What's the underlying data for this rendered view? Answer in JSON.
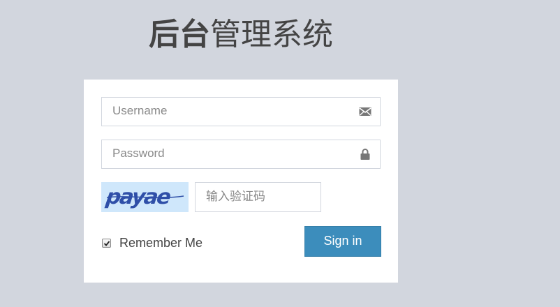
{
  "header": {
    "title_bold": "后台",
    "title_light": "管理系统"
  },
  "form": {
    "username": {
      "placeholder": "Username",
      "icon": "envelope-icon"
    },
    "password": {
      "placeholder": "Password",
      "icon": "lock-icon"
    },
    "captcha": {
      "image_text": "payae",
      "placeholder": "输入验证码"
    },
    "remember": {
      "label": "Remember Me",
      "checked": true
    },
    "submit_label": "Sign in"
  },
  "colors": {
    "background": "#d2d6de",
    "primary": "#3c8dbc",
    "captcha_bg": "#cfe7fb",
    "captcha_text": "#2f4fa8"
  }
}
